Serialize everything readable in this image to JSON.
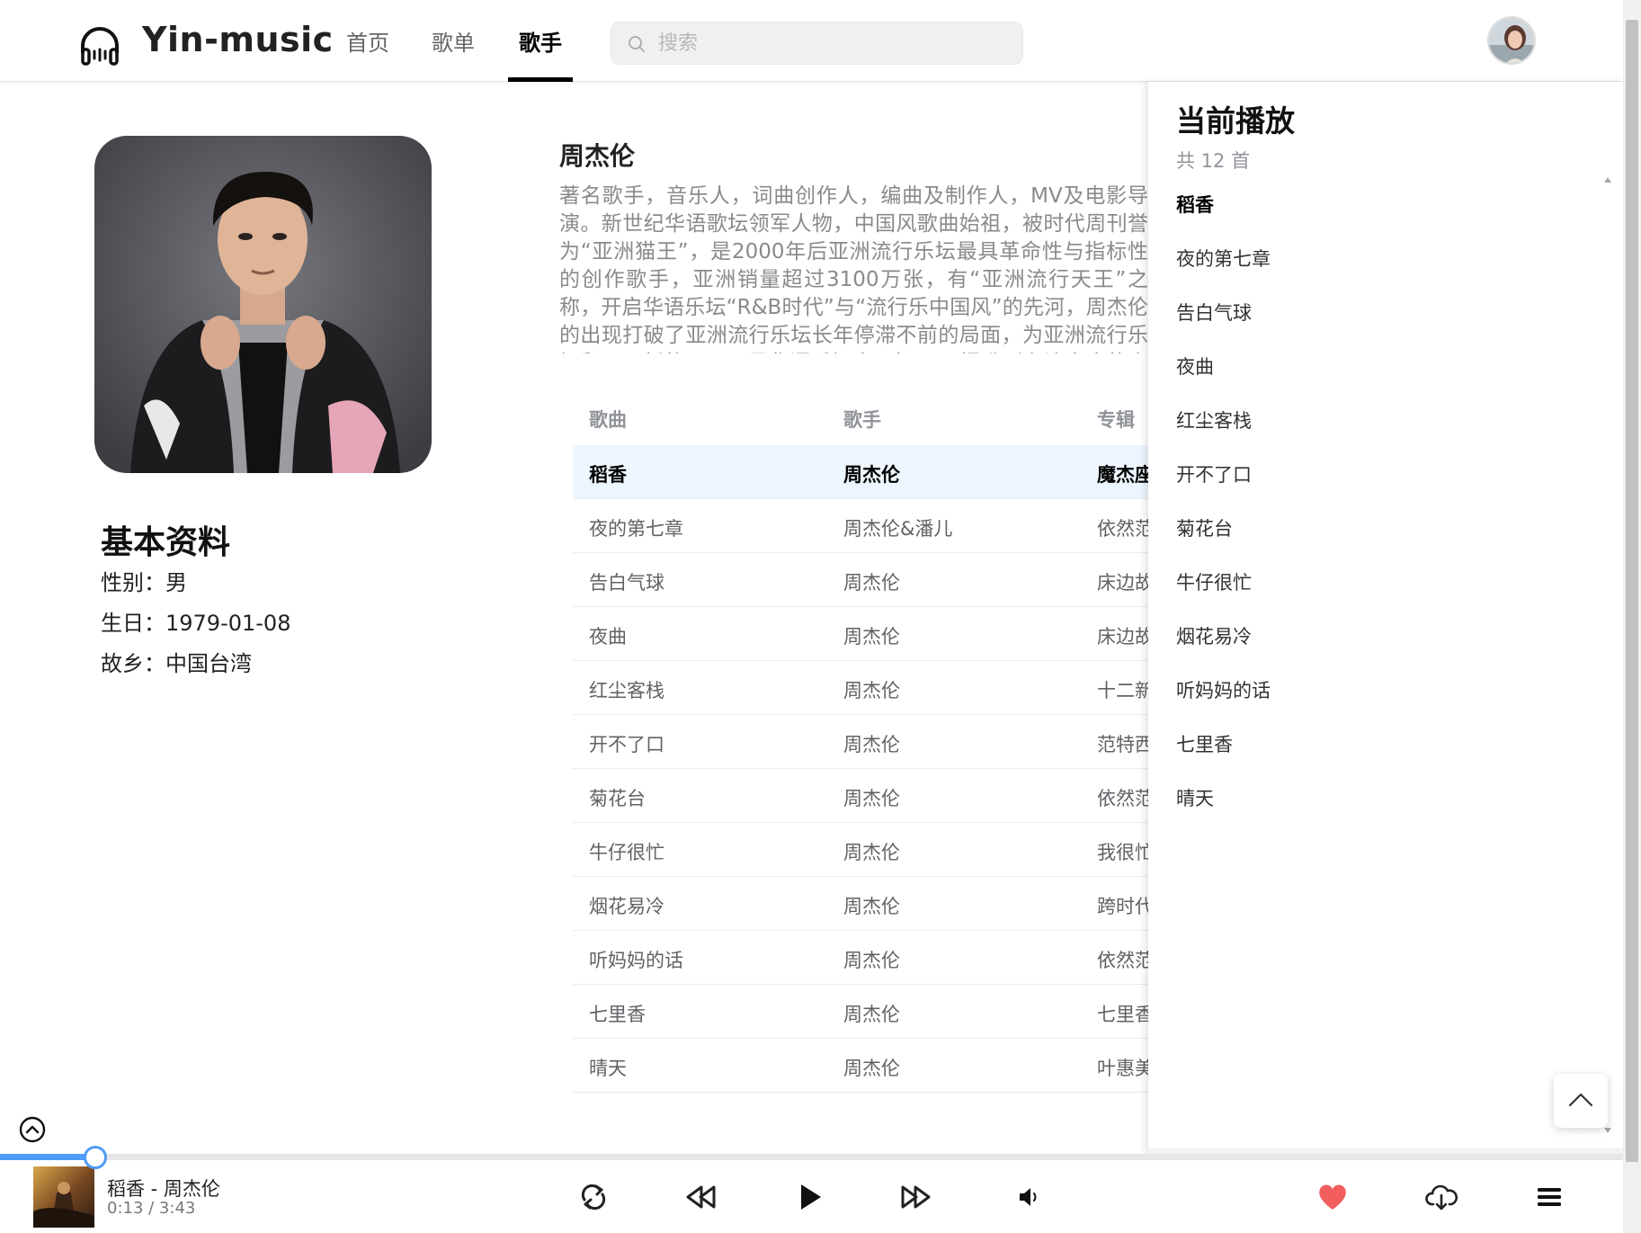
{
  "header": {
    "brand": "Yin-music",
    "nav": [
      "首页",
      "歌单",
      "歌手"
    ],
    "active_nav": "歌手",
    "search_placeholder": "搜索"
  },
  "singer": {
    "name": "周杰伦",
    "description": "著名歌手，音乐人，词曲创作人，编曲及制作人，MV及电影导演。新世纪华语歌坛领军人物，中国风歌曲始祖，被时代周刊誉为“亚洲猫王”，是2000年后亚洲流行乐坛最具革命性与指标性的创作歌手，亚洲销量超过3100万张，有“亚洲流行天王”之称，开启华语乐坛“R&B时代”与“流行乐中国风”的先河，周杰伦的出现打破了亚洲流行乐坛长年停滞不前的局面，为亚洲流行乐坛翻开了新的一页，是华语乐坛真正把R&B提升到主流高度的人物，将华语乐坛革命整十年，改写了华语乐坛的流行方向。",
    "info_title": "基本资料",
    "gender": "性别：男",
    "birthday": "生日：1979-01-08",
    "hometown": "故乡：中国台湾"
  },
  "table": {
    "headers": [
      "歌曲",
      "歌手",
      "专辑"
    ],
    "rows": [
      {
        "song": "稻香",
        "singer": "周杰伦",
        "album": "魔杰座"
      },
      {
        "song": "夜的第七章",
        "singer": "周杰伦&潘儿",
        "album": "依然范特西"
      },
      {
        "song": "告白气球",
        "singer": "周杰伦",
        "album": "床边故事"
      },
      {
        "song": "夜曲",
        "singer": "周杰伦",
        "album": "床边故事"
      },
      {
        "song": "红尘客栈",
        "singer": "周杰伦",
        "album": "十二新作"
      },
      {
        "song": "开不了口",
        "singer": "周杰伦",
        "album": "范特西"
      },
      {
        "song": "菊花台",
        "singer": "周杰伦",
        "album": "依然范特西"
      },
      {
        "song": "牛仔很忙",
        "singer": "周杰伦",
        "album": "我很忙"
      },
      {
        "song": "烟花易冷",
        "singer": "周杰伦",
        "album": "跨时代"
      },
      {
        "song": "听妈妈的话",
        "singer": "周杰伦",
        "album": "依然范特西"
      },
      {
        "song": "七里香",
        "singer": "周杰伦",
        "album": "七里香"
      },
      {
        "song": "晴天",
        "singer": "周杰伦",
        "album": "叶惠美"
      }
    ]
  },
  "playlist": {
    "title": "当前播放",
    "count": "共 12 首",
    "items": [
      "稻香",
      "夜的第七章",
      "告白气球",
      "夜曲",
      "红尘客栈",
      "开不了口",
      "菊花台",
      "牛仔很忙",
      "烟花易冷",
      "听妈妈的话",
      "七里香",
      "晴天"
    ]
  },
  "player": {
    "title": "稻香 - 周杰伦",
    "time": "0:13 / 3:43",
    "progress": 0.059,
    "icons": [
      "loop-icon",
      "previous-icon",
      "play-icon",
      "next-icon",
      "volume-icon",
      "like-icon",
      "download-icon",
      "playlist-icon"
    ]
  },
  "colors": {
    "accent": "#4f9bf5",
    "like": "#f25d5d",
    "row_highlight": "#edf5ff"
  }
}
